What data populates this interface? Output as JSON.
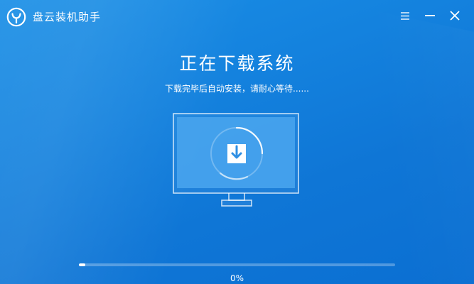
{
  "app": {
    "title": "盘云装机助手",
    "logo_icon": "app-logo-icon"
  },
  "titlebar": {
    "menu_icon": "menu-icon",
    "minimize_icon": "minimize-icon",
    "close_icon": "close-icon"
  },
  "main": {
    "headline": "正在下载系统",
    "subline": "下载完毕后自动安装，请耐心等待......"
  },
  "illustration": {
    "monitor_icon": "monitor-icon",
    "download_icon": "download-icon"
  },
  "progress": {
    "value": 0.02,
    "label": "0%"
  },
  "colors": {
    "background": "#1482de",
    "foreground": "#ffffff",
    "monitor_screen": "#4aa6ee"
  }
}
